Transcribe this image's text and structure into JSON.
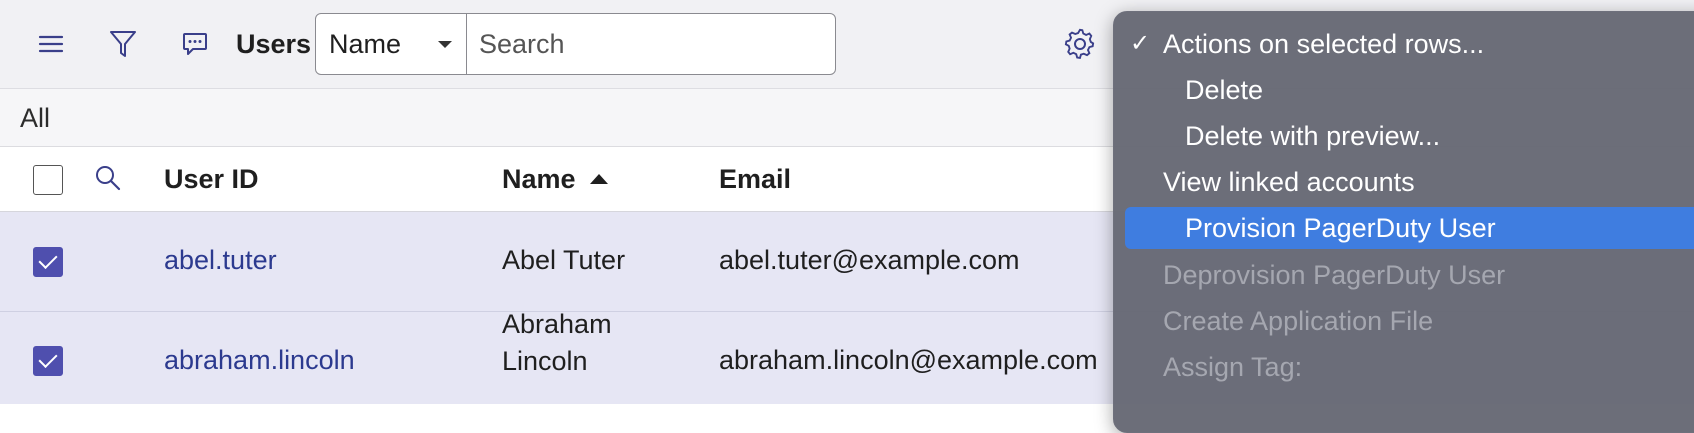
{
  "header": {
    "title": "Users",
    "field_select": {
      "selected": "Name"
    },
    "search": {
      "placeholder": "Search",
      "value": ""
    }
  },
  "filter": {
    "breadcrumb": "All"
  },
  "table": {
    "columns": [
      "User ID",
      "Name",
      "Email"
    ],
    "sort": {
      "column": "Name",
      "direction": "ascending"
    },
    "rows": [
      {
        "checked": true,
        "user_id": "abel.tuter",
        "name_line1": "Abel Tuter",
        "name_line2": "",
        "email": "abel.tuter@example.com"
      },
      {
        "checked": true,
        "user_id": "abraham.lincoln",
        "name_line1": "Abraham",
        "name_line2": "Lincoln",
        "email": "abraham.lincoln@example.com"
      }
    ]
  },
  "menu": {
    "items": [
      {
        "label": "Actions on selected rows...",
        "checked": true,
        "enabled": true,
        "highlighted": false
      },
      {
        "label": "Delete",
        "checked": false,
        "enabled": true,
        "highlighted": false
      },
      {
        "label": "Delete with preview...",
        "checked": false,
        "enabled": true,
        "highlighted": false
      },
      {
        "label": "View linked accounts",
        "checked": false,
        "enabled": true,
        "highlighted": false
      },
      {
        "label": "Provision PagerDuty User",
        "checked": false,
        "enabled": true,
        "highlighted": true
      },
      {
        "label": "Deprovision PagerDuty User",
        "checked": false,
        "enabled": false,
        "highlighted": false
      },
      {
        "label": "Create Application File",
        "checked": false,
        "enabled": false,
        "highlighted": false
      },
      {
        "label": "Assign Tag:",
        "checked": false,
        "enabled": false,
        "highlighted": false
      }
    ],
    "check_glyph": "✓"
  },
  "colors": {
    "accent": "#4f4fae",
    "link": "#2c3a8f",
    "selected_row": "#e6e6f4",
    "menu_bg": "#666874",
    "menu_highlight": "#3f7de0"
  }
}
